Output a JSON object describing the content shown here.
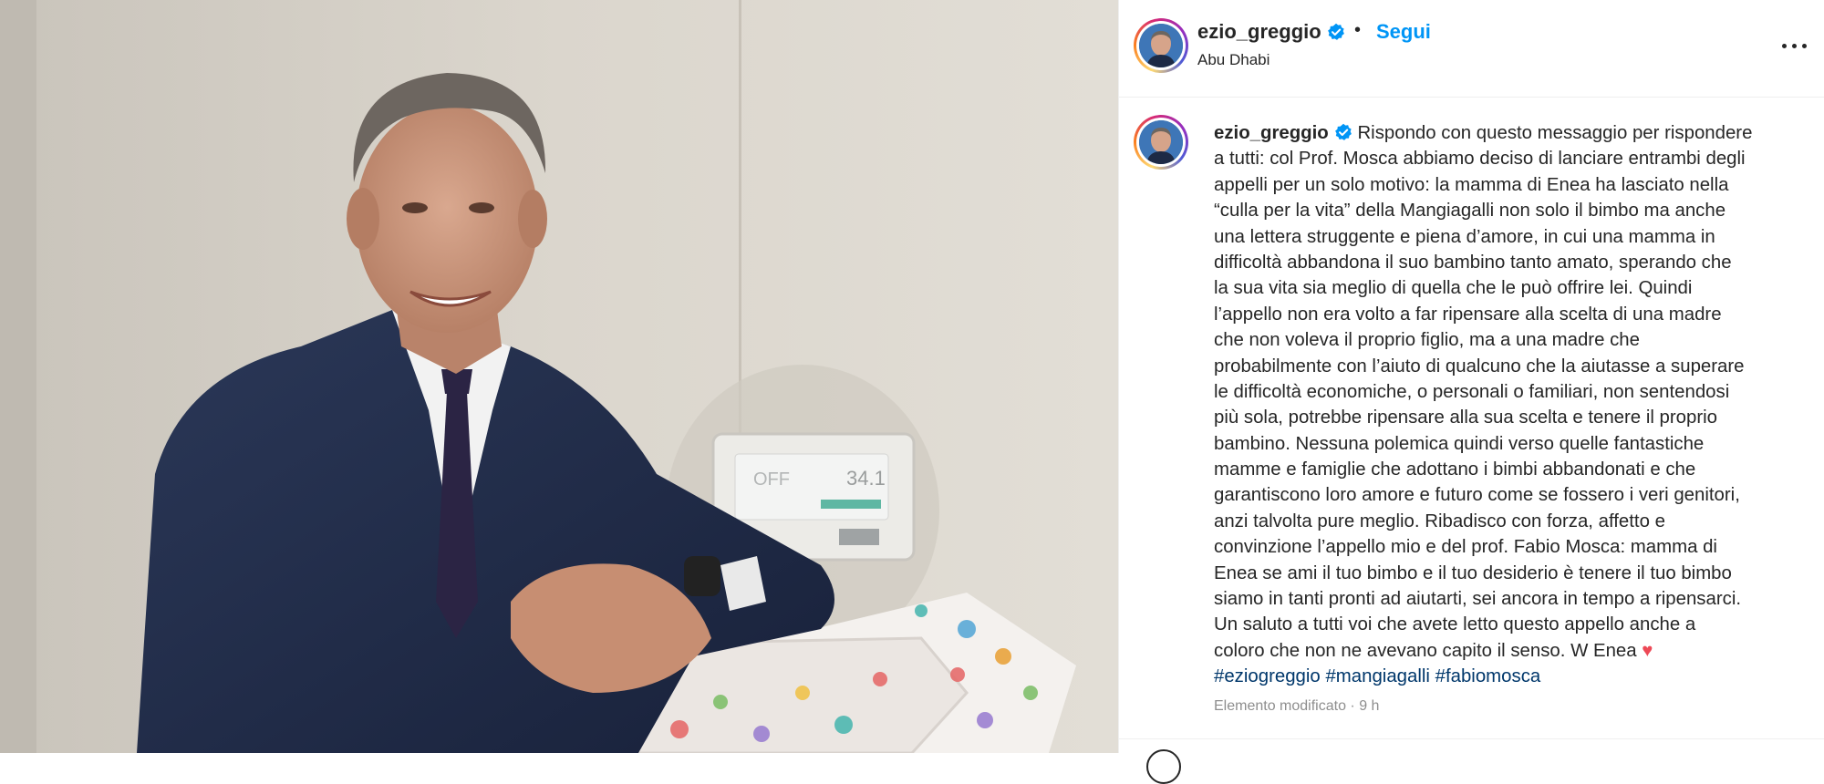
{
  "post": {
    "username": "ezio_greggio",
    "verified": true,
    "separator": "•",
    "follow_label": "Segui",
    "location": "Abu Dhabi",
    "caption_lines": [
      "Rispondo con questo messaggio per rispondere",
      "a tutti: col Prof. Mosca abbiamo deciso di lanciare entrambi degli",
      "appelli per un solo motivo: la mamma di Enea ha lasciato nella",
      "“culla per la vita” della Mangiagalli non solo il bimbo ma anche",
      "una lettera struggente e piena d’amore, in cui una mamma in",
      "difficoltà abbandona il suo bambino tanto amato, sperando che",
      "la sua vita sia meglio di quella che le può offrire lei. Quindi",
      "l’appello non era volto a far ripensare alla scelta di una madre",
      "che non voleva il proprio figlio, ma a una madre che",
      "probabilmente con l’aiuto di qualcuno che la aiutasse a superare",
      "le difficoltà economiche, o personali o familiari, non sentendosi",
      "più sola, potrebbe ripensare alla sua scelta e tenere il proprio",
      "bambino. Nessuna polemica quindi verso quelle fantastiche",
      "mamme e famiglie che adottano i bimbi abbandonati e che",
      "garantiscono loro amore e futuro come se fossero i veri genitori,",
      "anzi talvolta pure meglio. Ribadisco con forza, affetto e",
      "convinzione l’appello mio e del prof. Fabio Mosca: mamma di",
      "Enea se ami il tuo bimbo e il tuo desiderio è tenere il tuo bimbo",
      "siamo in tanti pronti ad aiutarti, sei ancora in tempo a ripensarci.",
      "Un saluto a tutti voi che avete letto questo appello anche a",
      "coloro che non ne avevano capito il senso. W Enea"
    ],
    "heart": "♥",
    "hashtags": [
      "#eziogreggio",
      "#mangiagalli",
      "#fabiomosca"
    ],
    "edited_label": "Elemento modificato",
    "meta_separator": "·",
    "time": "9 h"
  },
  "photo": {
    "machine_display": {
      "left": "OFF",
      "right": "34.1"
    }
  },
  "icons": {
    "verified": "verified-badge-icon",
    "more": "more-options-icon",
    "heart": "heart-emoji-icon"
  },
  "colors": {
    "follow": "#0095f6",
    "hashtag": "#00376b",
    "verified": "#0095f6",
    "heart": "#ed4956",
    "meta": "#8e8e8e"
  }
}
